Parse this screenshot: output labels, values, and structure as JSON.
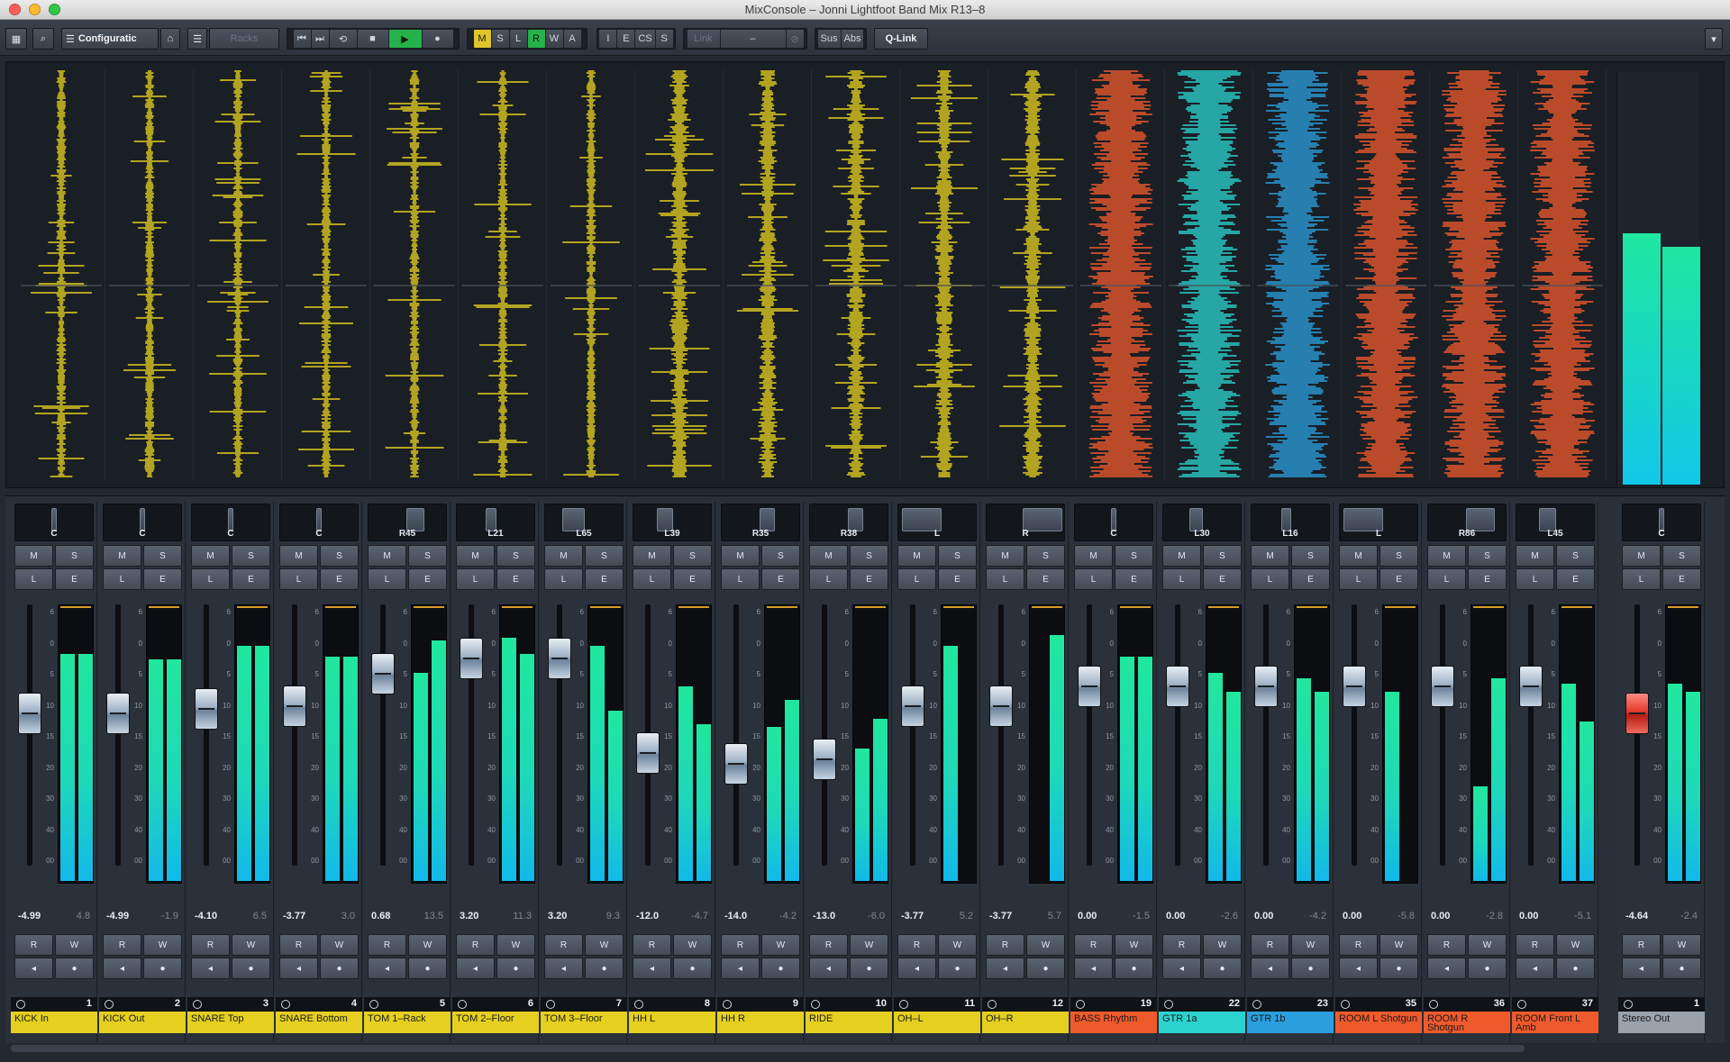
{
  "window": {
    "title": "MixConsole – Jonni Lightfoot Band Mix R13–8",
    "traffic_lights": [
      "#fc5f57",
      "#fdbc2e",
      "#33c748"
    ]
  },
  "toolbar": {
    "configurations_label": "Configuratic",
    "racks_label": "Racks",
    "msl": [
      "M",
      "S",
      "L",
      "R",
      "W",
      "A"
    ],
    "ies": [
      "I",
      "E",
      "CS",
      "S"
    ],
    "link_label": "Link",
    "link_value": "–",
    "sus_label": "Sus",
    "abs_label": "Abs",
    "qlink_label": "Q-Link"
  },
  "colors": {
    "yellow": "#e5d01f",
    "orange": "#ef5a2c",
    "teal": "#2bd3cf",
    "blue": "#2b9fdd",
    "gray": "#9aa2ac"
  },
  "strip_buttons": {
    "mute": "M",
    "solo": "S",
    "listen": "L",
    "edit": "E",
    "read": "R",
    "write": "W"
  },
  "channels": [
    {
      "name": "KICK In",
      "number": "1",
      "pan": "C",
      "vol": "-4.99",
      "peak": "4.8",
      "color": "yellow",
      "wave": "yellow",
      "fader": 0.6,
      "m1": 0.84,
      "m2": 0.84
    },
    {
      "name": "KICK Out",
      "number": "2",
      "pan": "C",
      "vol": "-4.99",
      "peak": "-1.9",
      "color": "yellow",
      "wave": "yellow",
      "fader": 0.6,
      "m1": 0.82,
      "m2": 0.82
    },
    {
      "name": "SNARE Top",
      "number": "3",
      "pan": "C",
      "vol": "-4.10",
      "peak": "6.5",
      "color": "yellow",
      "wave": "yellow",
      "fader": 0.62,
      "m1": 0.87,
      "m2": 0.87
    },
    {
      "name": "SNARE Bottom",
      "number": "4",
      "pan": "C",
      "vol": "-3.77",
      "peak": "3.0",
      "color": "yellow",
      "wave": "yellow",
      "fader": 0.63,
      "m1": 0.83,
      "m2": 0.83
    },
    {
      "name": "TOM 1–Rack",
      "number": "5",
      "pan": "R45",
      "vol": "0.68",
      "peak": "13.5",
      "color": "yellow",
      "wave": "yellow",
      "fader": 0.78,
      "m1": 0.77,
      "m2": 0.89
    },
    {
      "name": "TOM 2–Floor",
      "number": "6",
      "pan": "L21",
      "vol": "3.20",
      "peak": "11.3",
      "color": "yellow",
      "wave": "yellow",
      "fader": 0.85,
      "m1": 0.9,
      "m2": 0.84
    },
    {
      "name": "TOM 3–Floor",
      "number": "7",
      "pan": "L65",
      "vol": "3.20",
      "peak": "9.3",
      "color": "yellow",
      "wave": "yellow",
      "fader": 0.85,
      "m1": 0.87,
      "m2": 0.63
    },
    {
      "name": "HH L",
      "number": "8",
      "pan": "L39",
      "vol": "-12.0",
      "peak": "-4.7",
      "color": "yellow",
      "wave": "yellow",
      "fader": 0.42,
      "m1": 0.72,
      "m2": 0.58
    },
    {
      "name": "HH R",
      "number": "9",
      "pan": "R35",
      "vol": "-14.0",
      "peak": "-4.2",
      "color": "yellow",
      "wave": "yellow",
      "fader": 0.37,
      "m1": 0.57,
      "m2": 0.67
    },
    {
      "name": "RIDE",
      "number": "10",
      "pan": "R38",
      "vol": "-13.0",
      "peak": "-6.0",
      "color": "yellow",
      "wave": "yellow",
      "fader": 0.39,
      "m1": 0.49,
      "m2": 0.6
    },
    {
      "name": "OH–L",
      "number": "11",
      "pan": "L",
      "vol": "-3.77",
      "peak": "5.2",
      "color": "yellow",
      "wave": "yellow",
      "fader": 0.63,
      "m1": 0.87,
      "m2": 0.0
    },
    {
      "name": "OH–R",
      "number": "12",
      "pan": "R",
      "vol": "-3.77",
      "peak": "5.7",
      "color": "yellow",
      "wave": "yellow",
      "fader": 0.63,
      "m1": 0.0,
      "m2": 0.91
    },
    {
      "name": "BASS Rhythm",
      "number": "19",
      "pan": "C",
      "vol": "0.00",
      "peak": "-1.5",
      "color": "orange",
      "wave": "orange",
      "fader": 0.72,
      "m1": 0.83,
      "m2": 0.83
    },
    {
      "name": "GTR 1a",
      "number": "22",
      "pan": "L30",
      "vol": "0.00",
      "peak": "-2.6",
      "color": "teal",
      "wave": "teal",
      "fader": 0.72,
      "m1": 0.77,
      "m2": 0.7
    },
    {
      "name": "GTR 1b",
      "number": "23",
      "pan": "L16",
      "vol": "0.00",
      "peak": "-4.2",
      "color": "blue",
      "wave": "blue",
      "fader": 0.72,
      "m1": 0.75,
      "m2": 0.7
    },
    {
      "name": "ROOM L Shotgun",
      "number": "35",
      "pan": "L",
      "vol": "0.00",
      "peak": "-5.8",
      "color": "orange",
      "wave": "orange",
      "fader": 0.72,
      "m1": 0.7,
      "m2": 0.0
    },
    {
      "name": "ROOM R Shotgun",
      "number": "36",
      "pan": "R86",
      "vol": "0.00",
      "peak": "-2.8",
      "color": "orange",
      "wave": "orange",
      "fader": 0.72,
      "m1": 0.35,
      "m2": 0.75
    },
    {
      "name": "ROOM Front L Amb",
      "number": "37",
      "pan": "L45",
      "vol": "0.00",
      "peak": "-5.1",
      "color": "orange",
      "wave": "orange",
      "fader": 0.72,
      "m1": 0.73,
      "m2": 0.59
    }
  ],
  "output": {
    "name": "Stereo Out",
    "number": "1",
    "pan": "C",
    "vol": "-4.64",
    "peak": "-2.4",
    "color": "gray",
    "fader": 0.6,
    "m1": 0.73,
    "m2": 0.7,
    "bridge_m1": 0.73,
    "bridge_m2": 0.69
  },
  "fader_scale": [
    "6",
    "0",
    "5",
    "10",
    "15",
    "20",
    "30",
    "40",
    "00"
  ]
}
